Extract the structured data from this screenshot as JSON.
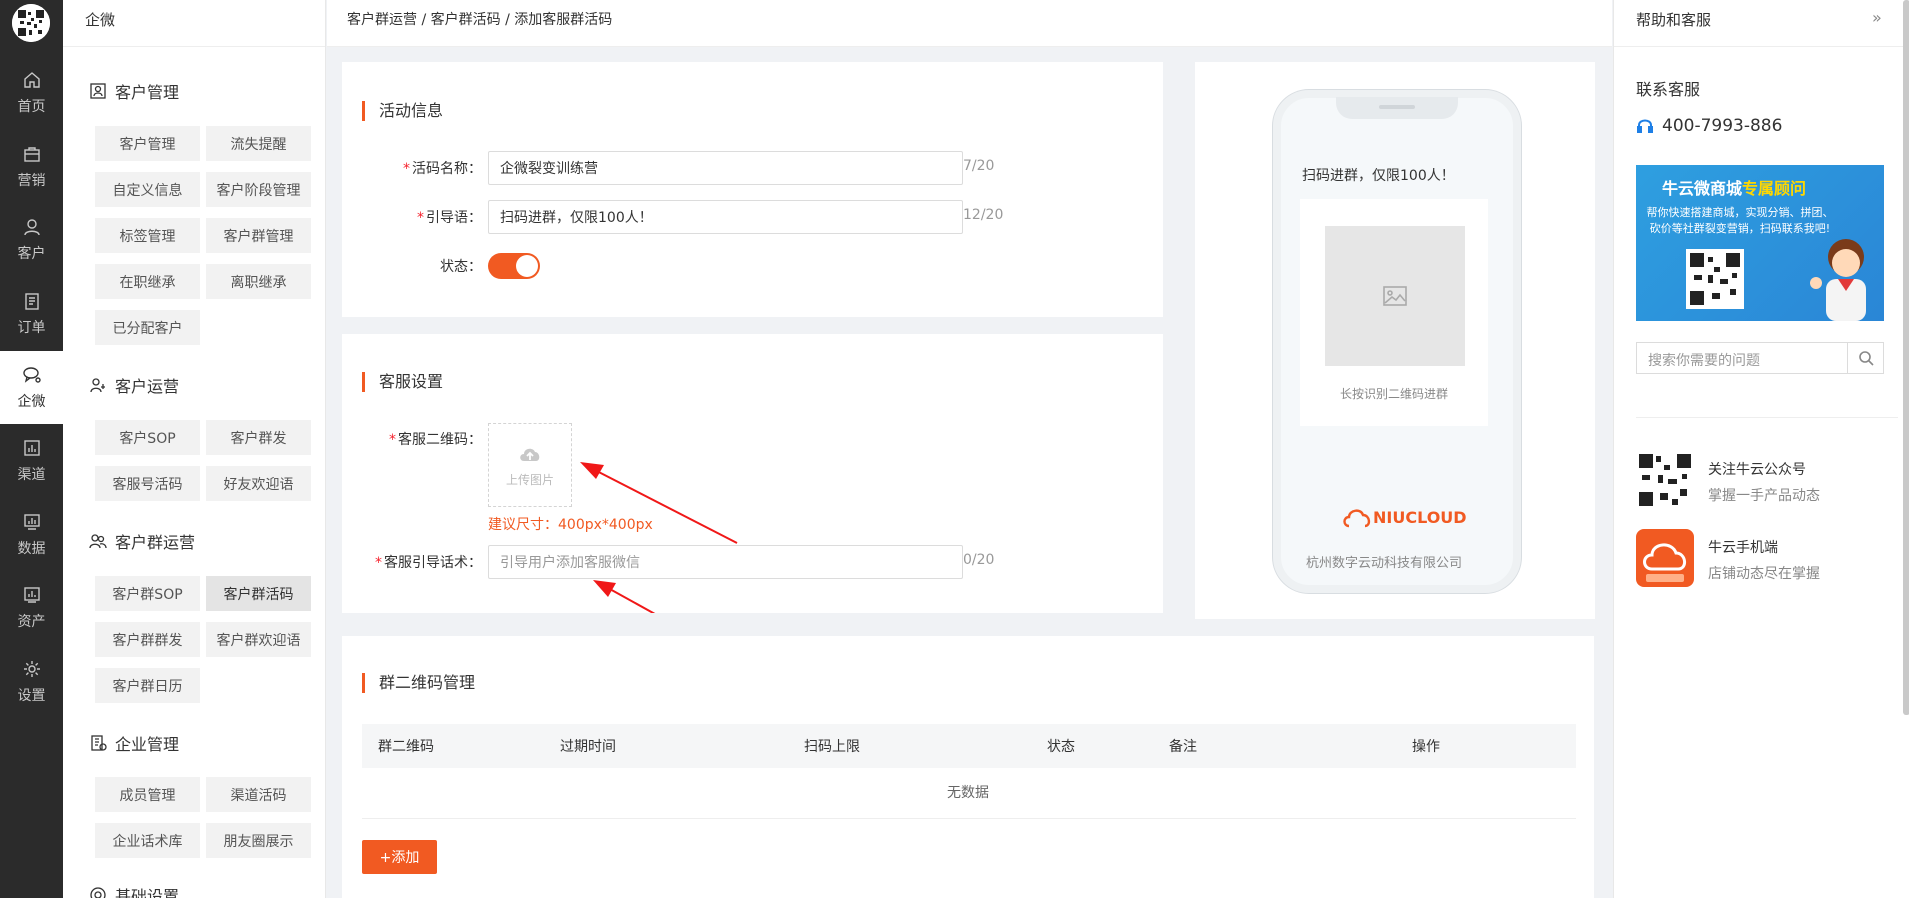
{
  "rail": {
    "items": [
      {
        "label": "首页",
        "icon": "home-icon"
      },
      {
        "label": "营销",
        "icon": "bag-icon"
      },
      {
        "label": "客户",
        "icon": "user-icon"
      },
      {
        "label": "订单",
        "icon": "order-icon"
      },
      {
        "label": "企微",
        "icon": "chat-icon",
        "active": true
      },
      {
        "label": "渠道",
        "icon": "bar-chart-icon"
      },
      {
        "label": "数据",
        "icon": "monitor-chart-icon"
      },
      {
        "label": "资产",
        "icon": "asset-chart-icon"
      },
      {
        "label": "设置",
        "icon": "gear-icon"
      }
    ]
  },
  "sidebar": {
    "title": "企微",
    "groups": [
      {
        "title": "客户管理",
        "items": [
          "客户管理",
          "流失提醒",
          "自定义信息",
          "客户阶段管理",
          "标签管理",
          "客户群管理",
          "在职继承",
          "离职继承",
          "已分配客户"
        ]
      },
      {
        "title": "客户运营",
        "items": [
          "客户SOP",
          "客户群发",
          "客服号活码",
          "好友欢迎语"
        ]
      },
      {
        "title": "客户群运营",
        "items": [
          "客户群SOP",
          "客户群活码",
          "客户群群发",
          "客户群欢迎语",
          "客户群日历"
        ],
        "active": "客户群活码"
      },
      {
        "title": "企业管理",
        "items": [
          "成员管理",
          "渠道活码",
          "企业话术库",
          "朋友圈展示"
        ]
      },
      {
        "title": "基础设置",
        "items": []
      }
    ]
  },
  "breadcrumb": "客户群运营 / 客户群活码 / 添加客服群活码",
  "activity": {
    "title": "活动信息",
    "name_label": "活码名称：",
    "name_value": "企微裂变训练营",
    "name_count": "7/20",
    "guide_label": "引导语：",
    "guide_value": "扫码进群，仅限100人！",
    "guide_count": "12/20",
    "status_label": "状态：",
    "status_on": true
  },
  "service": {
    "title": "客服设置",
    "qr_label": "客服二维码：",
    "upload_text": "上传图片",
    "hint": "建议尺寸：400px*400px",
    "script_label": "客服引导话术：",
    "script_placeholder": "引导用户添加客服微信",
    "script_count": "0/20"
  },
  "groups_table": {
    "title": "群二维码管理",
    "columns": [
      "群二维码",
      "过期时间",
      "扫码上限",
      "状态",
      "备注",
      "操作"
    ],
    "empty_text": "无数据",
    "add_label": "+添加"
  },
  "preview": {
    "guide_text": "扫码进群，仅限100人！",
    "qr_caption": "长按识别二维码进群",
    "brand": "NIUCLOUD",
    "company": "杭州数字云动科技有限公司"
  },
  "help": {
    "title": "帮助和客服",
    "contact_title": "联系客服",
    "phone": "400-7993-886",
    "banner_title_a": "牛云微商城",
    "banner_title_b": "专属顾问",
    "banner_sub": "帮你快速搭建商城，实现分销、拼团、砍价等社群裂变营销，扫码联系我吧!",
    "search_placeholder": "搜索你需要的问题",
    "follow": [
      {
        "title": "关注牛云公众号",
        "desc": "掌握一手产品动态",
        "icon": "qr-code-icon"
      },
      {
        "title": "牛云手机端",
        "desc": "店铺动态尽在掌握",
        "icon": "mobile-app-icon"
      }
    ]
  },
  "colors": {
    "accent": "#f15a22",
    "rail_bg": "#2b2b2b"
  }
}
